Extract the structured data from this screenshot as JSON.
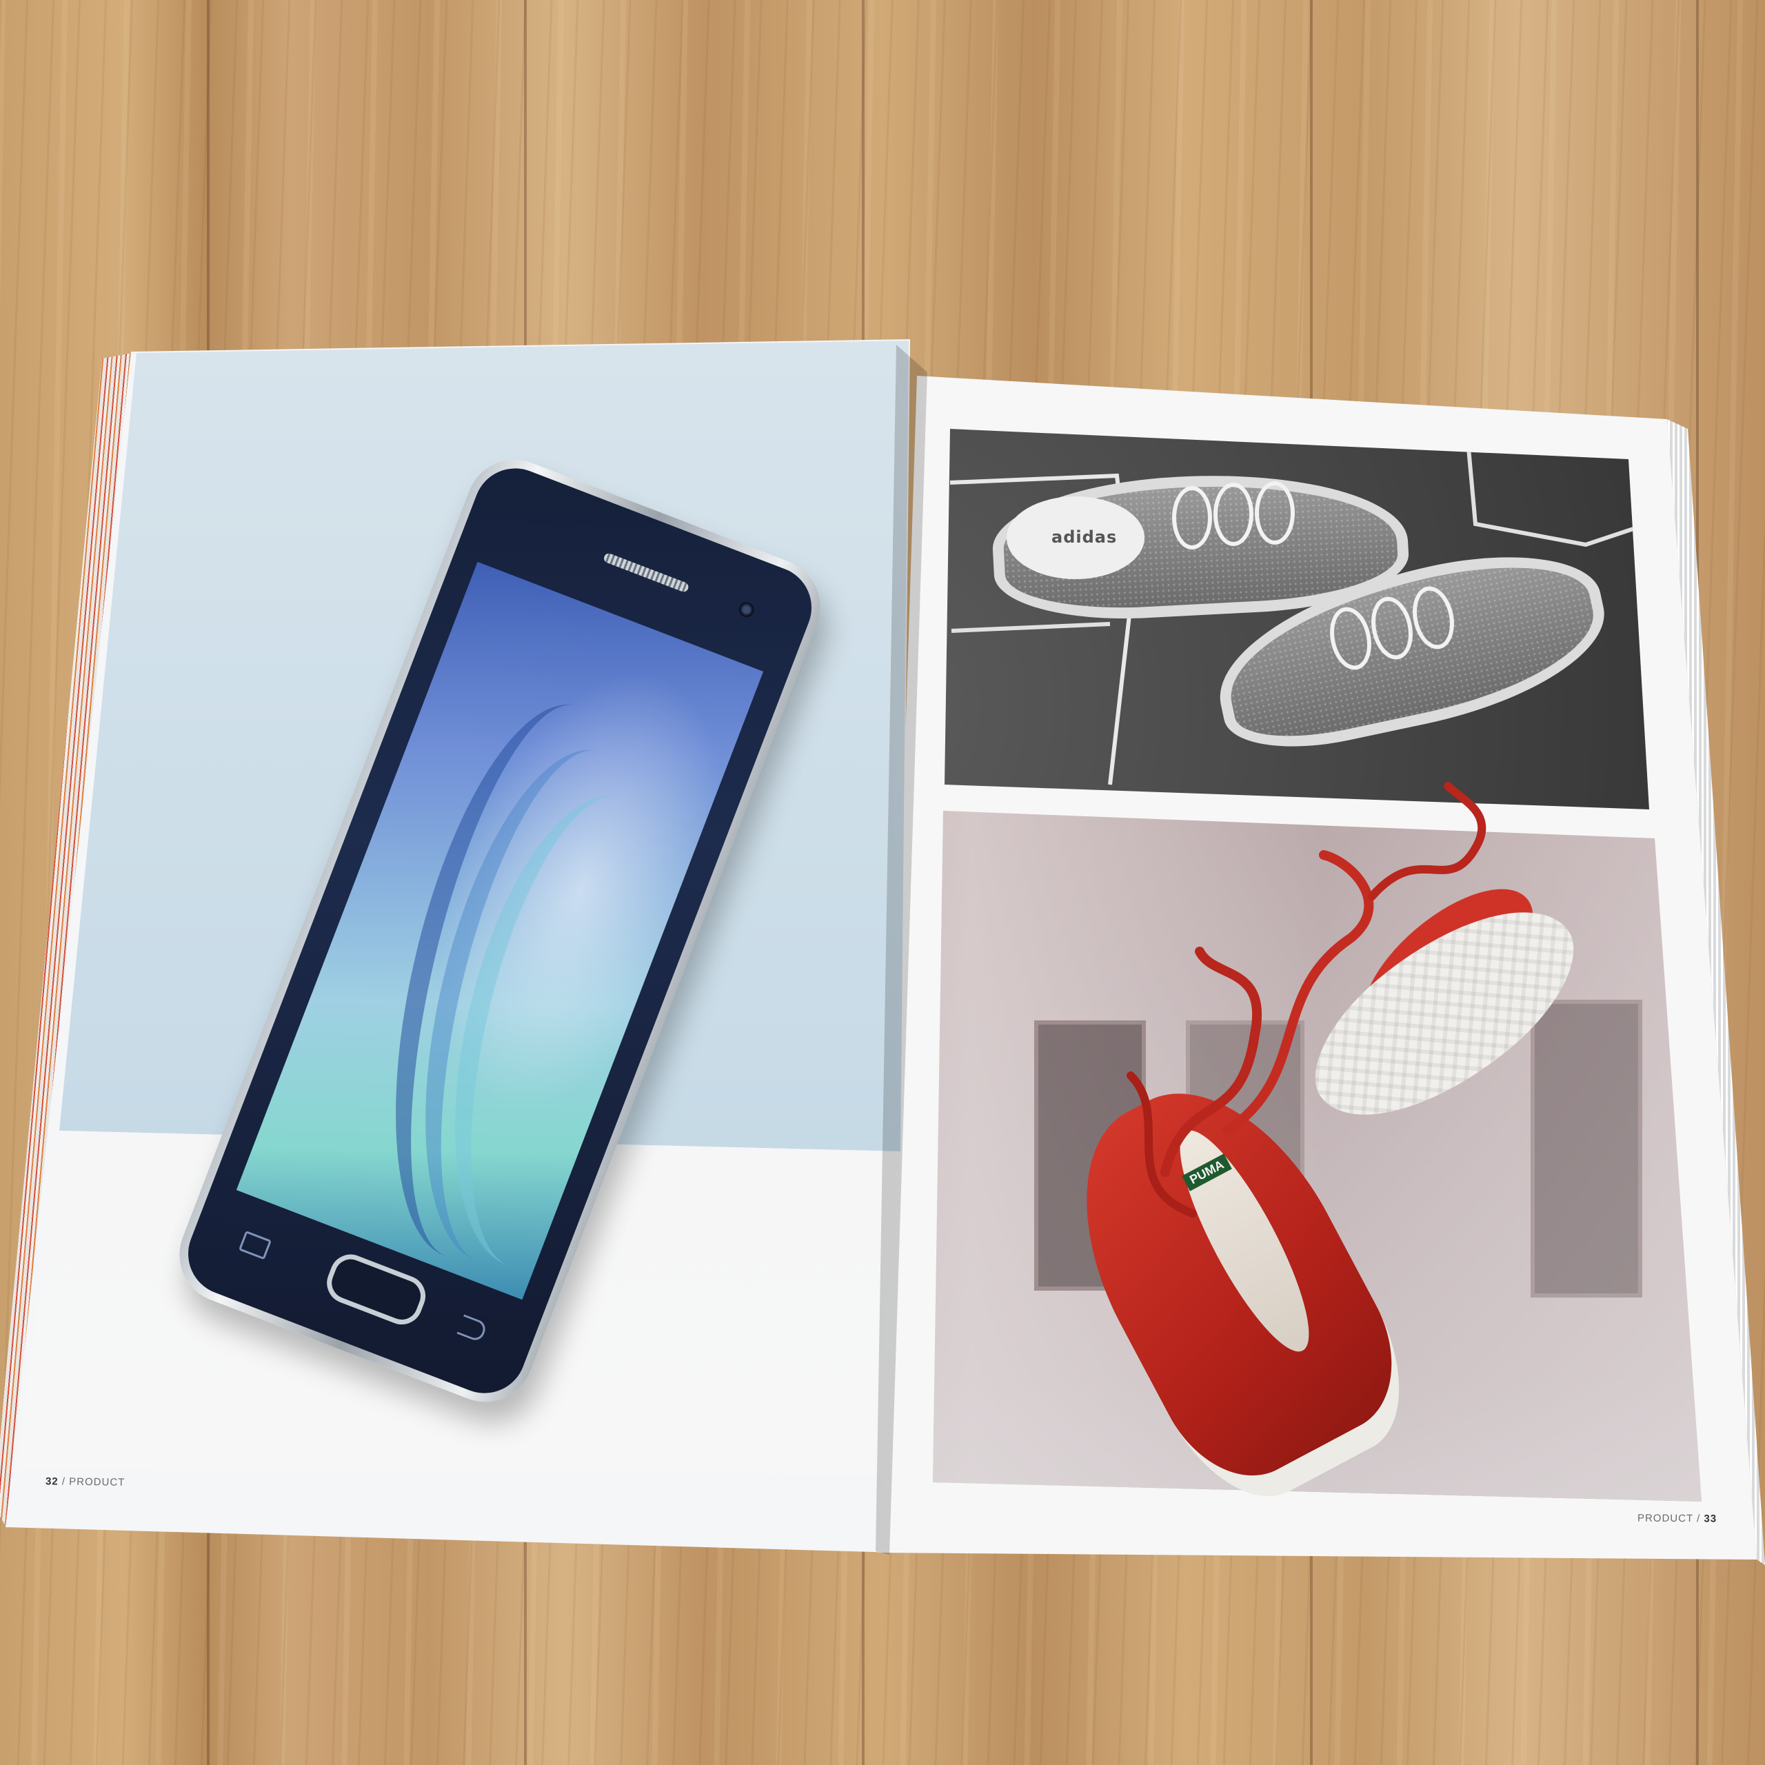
{
  "spread": {
    "left_page": {
      "number": "32",
      "separator": "/",
      "section": "PRODUCT"
    },
    "right_page": {
      "section": "PRODUCT",
      "separator": "/",
      "number": "33"
    }
  },
  "photos": {
    "adidas": {
      "brand_text": "adidas"
    },
    "puma": {
      "tongue_label": "PUMA"
    }
  },
  "colors": {
    "wood": "#c9a070",
    "phone_backdrop": "#c8dbe7",
    "shoe_red": "#c62d22",
    "adidas_backdrop": "#343434"
  }
}
